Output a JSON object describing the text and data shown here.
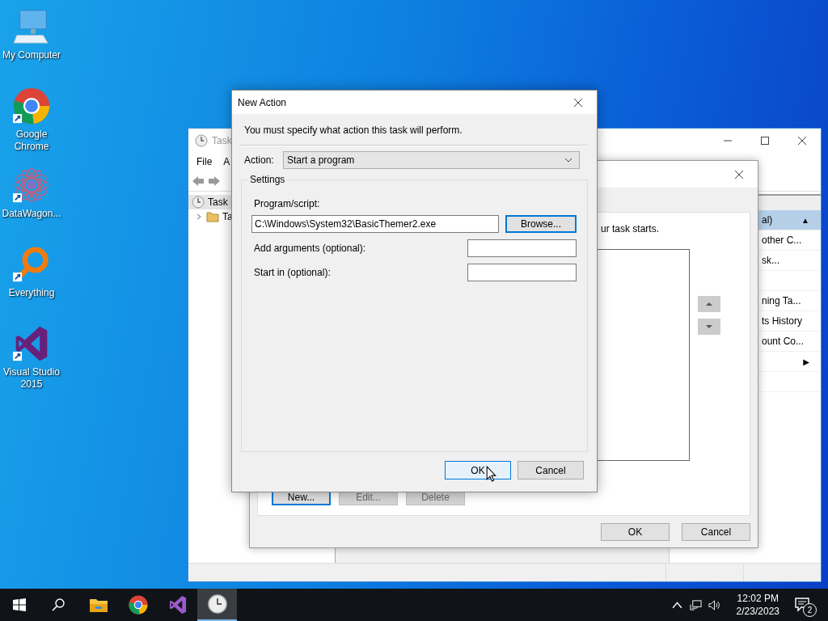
{
  "desktop_icons": [
    {
      "label": "My Computer",
      "kind": "computer",
      "shortcut": false
    },
    {
      "label": "Google Chrome",
      "kind": "chrome",
      "shortcut": true
    },
    {
      "label": "DataWagon...",
      "kind": "datawagon",
      "shortcut": true
    },
    {
      "label": "Everything",
      "kind": "everything",
      "shortcut": true
    },
    {
      "label": "Visual Studio 2015",
      "kind": "vs",
      "shortcut": true
    }
  ],
  "task_scheduler": {
    "title": "Task",
    "menu": [
      "File",
      "A"
    ],
    "tree": [
      {
        "label": "Task",
        "children": [
          {
            "label": "Ta",
            "expanded": false
          }
        ]
      }
    ],
    "actions": [
      {
        "label": "al)",
        "selected": true,
        "toggle": "▲"
      },
      {
        "label": "other C...",
        "selected": false
      },
      {
        "label": "sk...",
        "selected": false
      },
      {
        "selected": false
      },
      {
        "label": "ning Ta...",
        "selected": false
      },
      {
        "label": "ts History",
        "selected": false
      },
      {
        "label": "ount Co...",
        "selected": false
      },
      {
        "selected": false,
        "arrow": "▶"
      },
      {
        "selected": false
      }
    ]
  },
  "create_task": {
    "text": "ur task starts.",
    "buttons": [
      {
        "label": "New...",
        "disabled": false,
        "focused": true
      },
      {
        "label": "Edit...",
        "disabled": true,
        "focused": false
      },
      {
        "label": "Delete",
        "disabled": true,
        "focused": false
      }
    ],
    "ok": "OK",
    "cancel": "Cancel"
  },
  "new_action": {
    "title": "New Action",
    "instruction": "You must specify what action this task will perform.",
    "action_label": "Action:",
    "action_value": "Start a program",
    "group": "Settings",
    "program": {
      "label": "Program/script:",
      "value": "C:\\Windows\\System32\\BasicThemer2.exe"
    },
    "browse": {
      "label": "Browse...",
      "focused": true
    },
    "optional_fields": [
      {
        "label": "Add arguments (optional):"
      },
      {
        "label": "Start in (optional):"
      }
    ],
    "ok": {
      "label": "OK",
      "focused": true
    },
    "cancel": {
      "label": "Cancel",
      "focused": false
    }
  },
  "taskbar": {
    "apps": [
      {
        "kind": "explorer",
        "active": false
      },
      {
        "kind": "chrome",
        "active": false
      },
      {
        "kind": "vs",
        "active": false
      },
      {
        "kind": "scheduler",
        "active": true
      }
    ],
    "time": "12:02 PM",
    "date": "2/23/2023",
    "notifications": "2"
  }
}
